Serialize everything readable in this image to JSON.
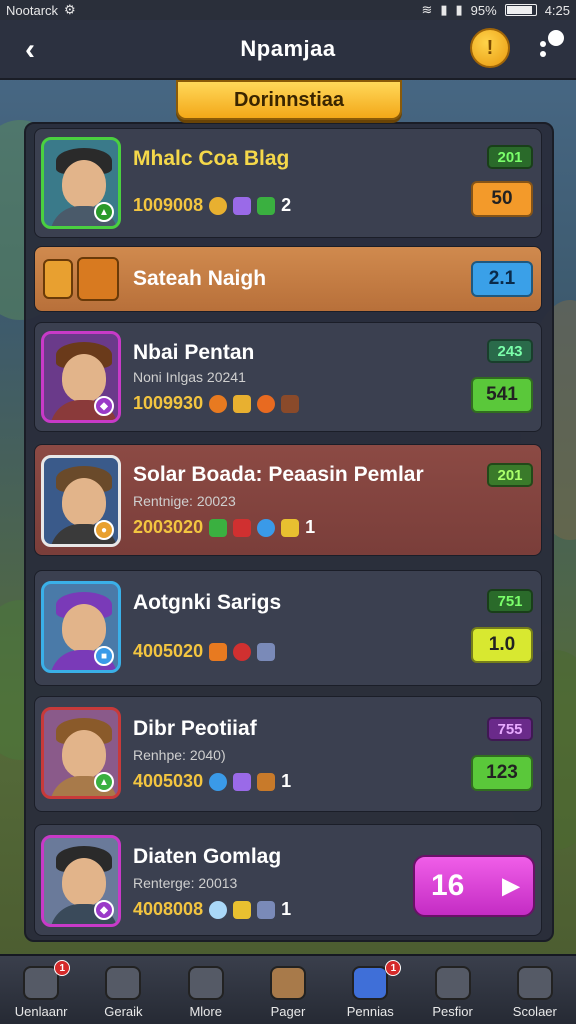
{
  "status_bar": {
    "carrier": "Nootarck",
    "battery": "95%",
    "time": "4:25"
  },
  "header": {
    "title": "Npamjaa",
    "back_badge": "",
    "more_badge": "1"
  },
  "ribbon": {
    "label": "Dorinnstiaa"
  },
  "rows": [
    {
      "name": "Mhalc Coa Blag",
      "sub": "",
      "stat": "1009008",
      "count": "2",
      "small": "201",
      "big": "50"
    },
    {
      "name": "Sateah Naigh",
      "sub": "",
      "stat": "",
      "count": "",
      "small": "",
      "big": "2.1"
    },
    {
      "name": "Nbai Pentan",
      "sub": "Noni Inlgas 20241",
      "stat": "1009930",
      "count": "",
      "small": "243",
      "big": "541"
    },
    {
      "name": "Solar Boada: Peaasin Pemlar",
      "sub": "Rentnige: 20023",
      "stat": "2003020",
      "count": "1",
      "small": "201",
      "big": ""
    },
    {
      "name": "Aotgnki Sarigs",
      "sub": "",
      "stat": "4005020",
      "count": "",
      "small": "751",
      "big": "1.0"
    },
    {
      "name": "Dibr Peotiiaf",
      "sub": "Renhpe: 2040)",
      "stat": "4005030",
      "count": "1",
      "small": "755",
      "big": "123"
    },
    {
      "name": "Diaten Gomlag",
      "sub": "Renterge: 20013",
      "stat": "4008008",
      "count": "1",
      "small": "",
      "big": ""
    }
  ],
  "action": {
    "label": "16"
  },
  "nav": [
    {
      "label": "Uenlaanr",
      "badge": "1"
    },
    {
      "label": "Geraik",
      "badge": ""
    },
    {
      "label": "Mlore",
      "badge": ""
    },
    {
      "label": "Pager",
      "badge": ""
    },
    {
      "label": "Pennias",
      "badge": "1"
    },
    {
      "label": "Pesfior",
      "badge": ""
    },
    {
      "label": "Scolaer",
      "badge": ""
    }
  ],
  "colors": {
    "accent_gold": "#f3c540",
    "ribbon": "#f3a818",
    "action": "#e04ad8"
  }
}
